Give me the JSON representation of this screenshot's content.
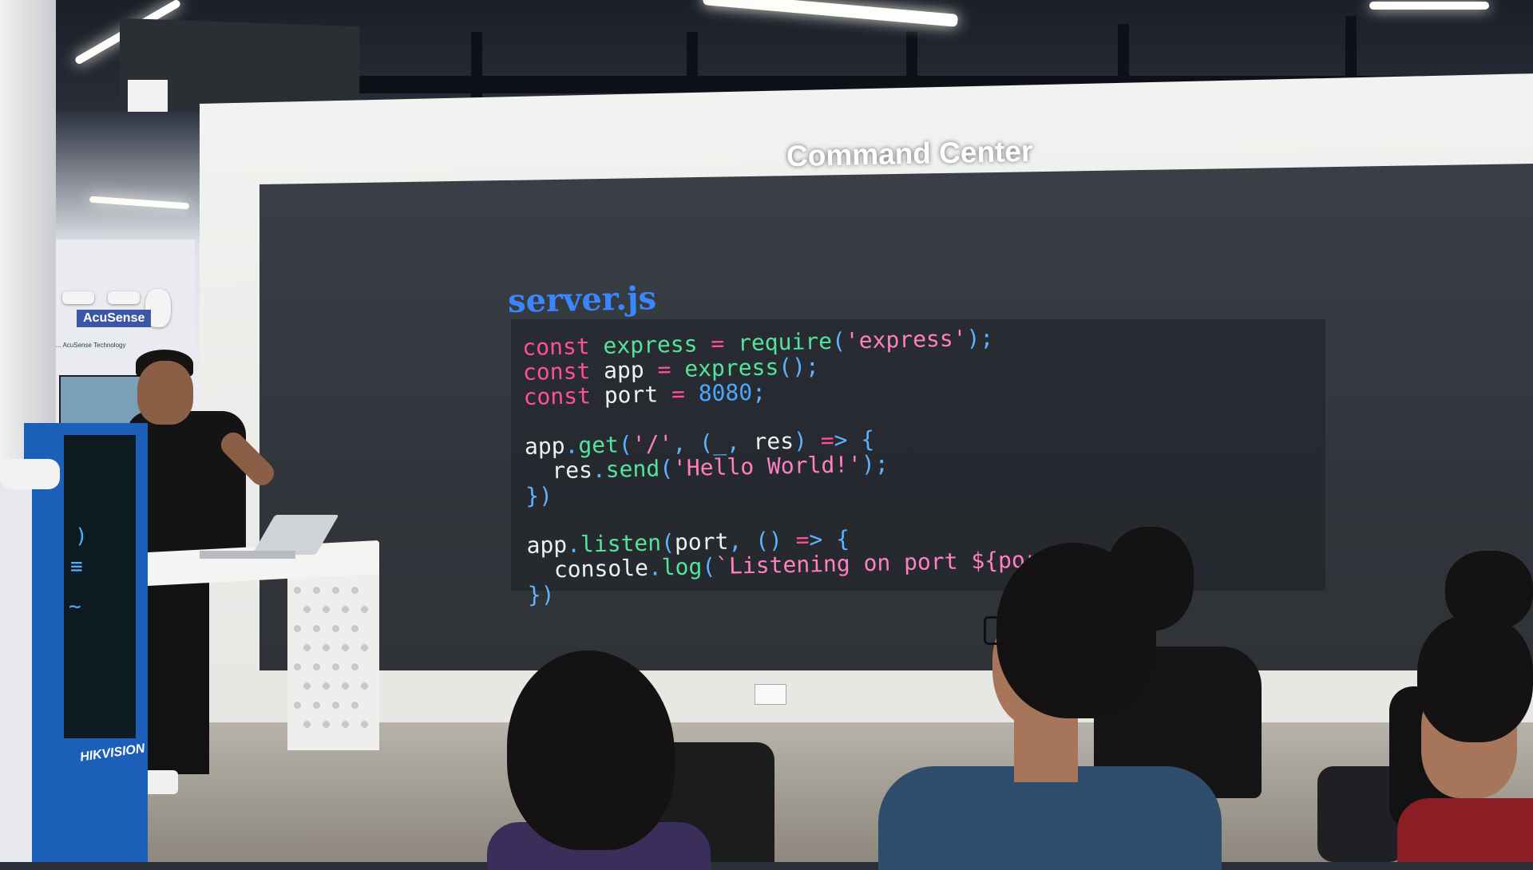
{
  "room": {
    "header_title": "Command Center",
    "wall_sign": "AcuSense",
    "wall_sign_sub": "... AcuSense Technology",
    "kiosk_brand": "HIKVISION"
  },
  "slide": {
    "file_name": "server.js",
    "code_lines": [
      "const express = require('express');",
      "const app = express();",
      "const port = 8080;",
      "",
      "app.get('/', (_, res) => {",
      "  res.send('Hello World!');",
      "})",
      "",
      "app.listen(port, () => {",
      "  console.log(`Listening on port ${port}`);",
      "})"
    ]
  },
  "colors": {
    "keyword": "#ff4f9a",
    "function": "#54e39a",
    "string": "#ff7fc2",
    "number": "#48a8ff",
    "punctuation": "#5fb2ff",
    "file_name": "#3a86ff",
    "screen_bg": "#363a41"
  }
}
